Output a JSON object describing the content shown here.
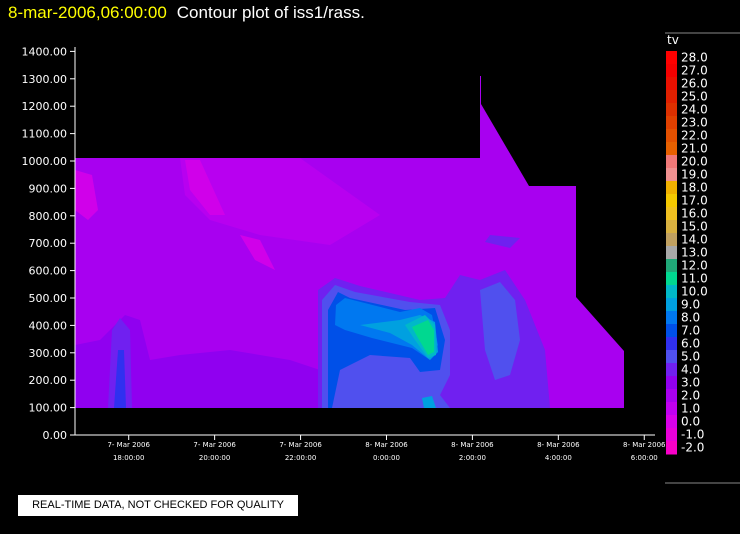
{
  "header": {
    "timestamp": "8-mar-2006,06:00:00",
    "title": "Contour plot of iss1/rass."
  },
  "footer": {
    "qc_notice": "REAL-TIME DATA, NOT CHECKED FOR QUALITY"
  },
  "chart_data": {
    "type": "contour",
    "title": "Contour plot of iss1/rass.",
    "variable": "tv",
    "x_ticks": [
      {
        "date": "7- Mar 2006",
        "time": "18:00:00"
      },
      {
        "date": "7- Mar 2006",
        "time": "20:00:00"
      },
      {
        "date": "7- Mar 2006",
        "time": "22:00:00"
      },
      {
        "date": "8- Mar 2006",
        "time": "0:00:00"
      },
      {
        "date": "8- Mar 2006",
        "time": "2:00:00"
      },
      {
        "date": "8- Mar 2006",
        "time": "4:00:00"
      },
      {
        "date": "8- Mar 2006",
        "time": "6:00:00"
      }
    ],
    "xlim": [
      "2006-03-07T16:45:00",
      "2006-03-08T06:15:00"
    ],
    "y_ticks": [
      "0.00",
      "100.00",
      "200.00",
      "300.00",
      "400.00",
      "500.00",
      "600.00",
      "700.00",
      "800.00",
      "900.00",
      "1000.00",
      "1100.00",
      "1200.00",
      "1300.00",
      "1400.00"
    ],
    "ylim": [
      0,
      1400
    ],
    "colorbar": {
      "label": "tv",
      "levels": [
        "28.0",
        "27.0",
        "26.0",
        "25.0",
        "24.0",
        "23.0",
        "22.0",
        "21.0",
        "20.0",
        "19.0",
        "18.0",
        "17.0",
        "16.0",
        "15.0",
        "14.0",
        "13.0",
        "12.0",
        "11.0",
        "10.0",
        "9.0",
        "8.0",
        "7.0",
        "6.0",
        "5.0",
        "4.0",
        "3.0",
        "2.0",
        "1.0",
        "0.0",
        "-1.0",
        "-2.0"
      ],
      "colors": [
        "#ff0000",
        "#f50000",
        "#ea1000",
        "#e02000",
        "#dd3000",
        "#e04000",
        "#e35000",
        "#e66000",
        "#f07878",
        "#ef9090",
        "#f0b000",
        "#f5c800",
        "#f0c020",
        "#d8b040",
        "#c0a060",
        "#a8a8a8",
        "#20a878",
        "#00d890",
        "#00b8c8",
        "#00a0e0",
        "#0078f0",
        "#0050e8",
        "#3030f0",
        "#5050ee",
        "#7020f0",
        "#9000f0",
        "#a800f0",
        "#c000f0",
        "#d800e8",
        "#e800d8",
        "#f800c8"
      ]
    }
  }
}
